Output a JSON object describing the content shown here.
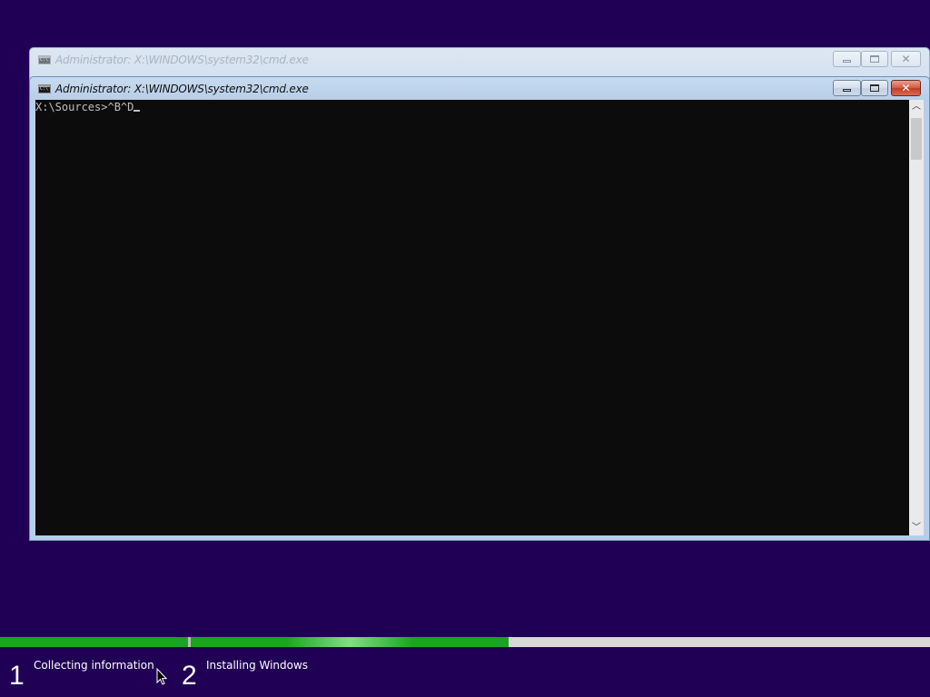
{
  "windows": [
    {
      "title": "Administrator: X:\\WINDOWS\\system32\\cmd.exe",
      "state": "inactive"
    },
    {
      "title": "Administrator: X:\\WINDOWS\\system32\\cmd.exe",
      "state": "active",
      "console": {
        "line": "X:\\Sources>^B^D"
      }
    }
  ],
  "setup": {
    "steps": [
      {
        "number": "1",
        "label": "Collecting information",
        "progress": 1.0
      },
      {
        "number": "2",
        "label": "Installing Windows",
        "progress": 0.43
      }
    ]
  },
  "colors": {
    "desktop": "#200054",
    "progress": "#16a621",
    "console_bg": "#0c0c0c",
    "console_text": "#c0c0c0"
  },
  "icons": {
    "app": "cmd-icon",
    "minimize": "minimize-icon",
    "maximize": "maximize-icon",
    "close": "close-icon",
    "scroll_up": "chevron-up-icon",
    "scroll_down": "chevron-down-icon",
    "pointer": "mouse-pointer-icon"
  }
}
